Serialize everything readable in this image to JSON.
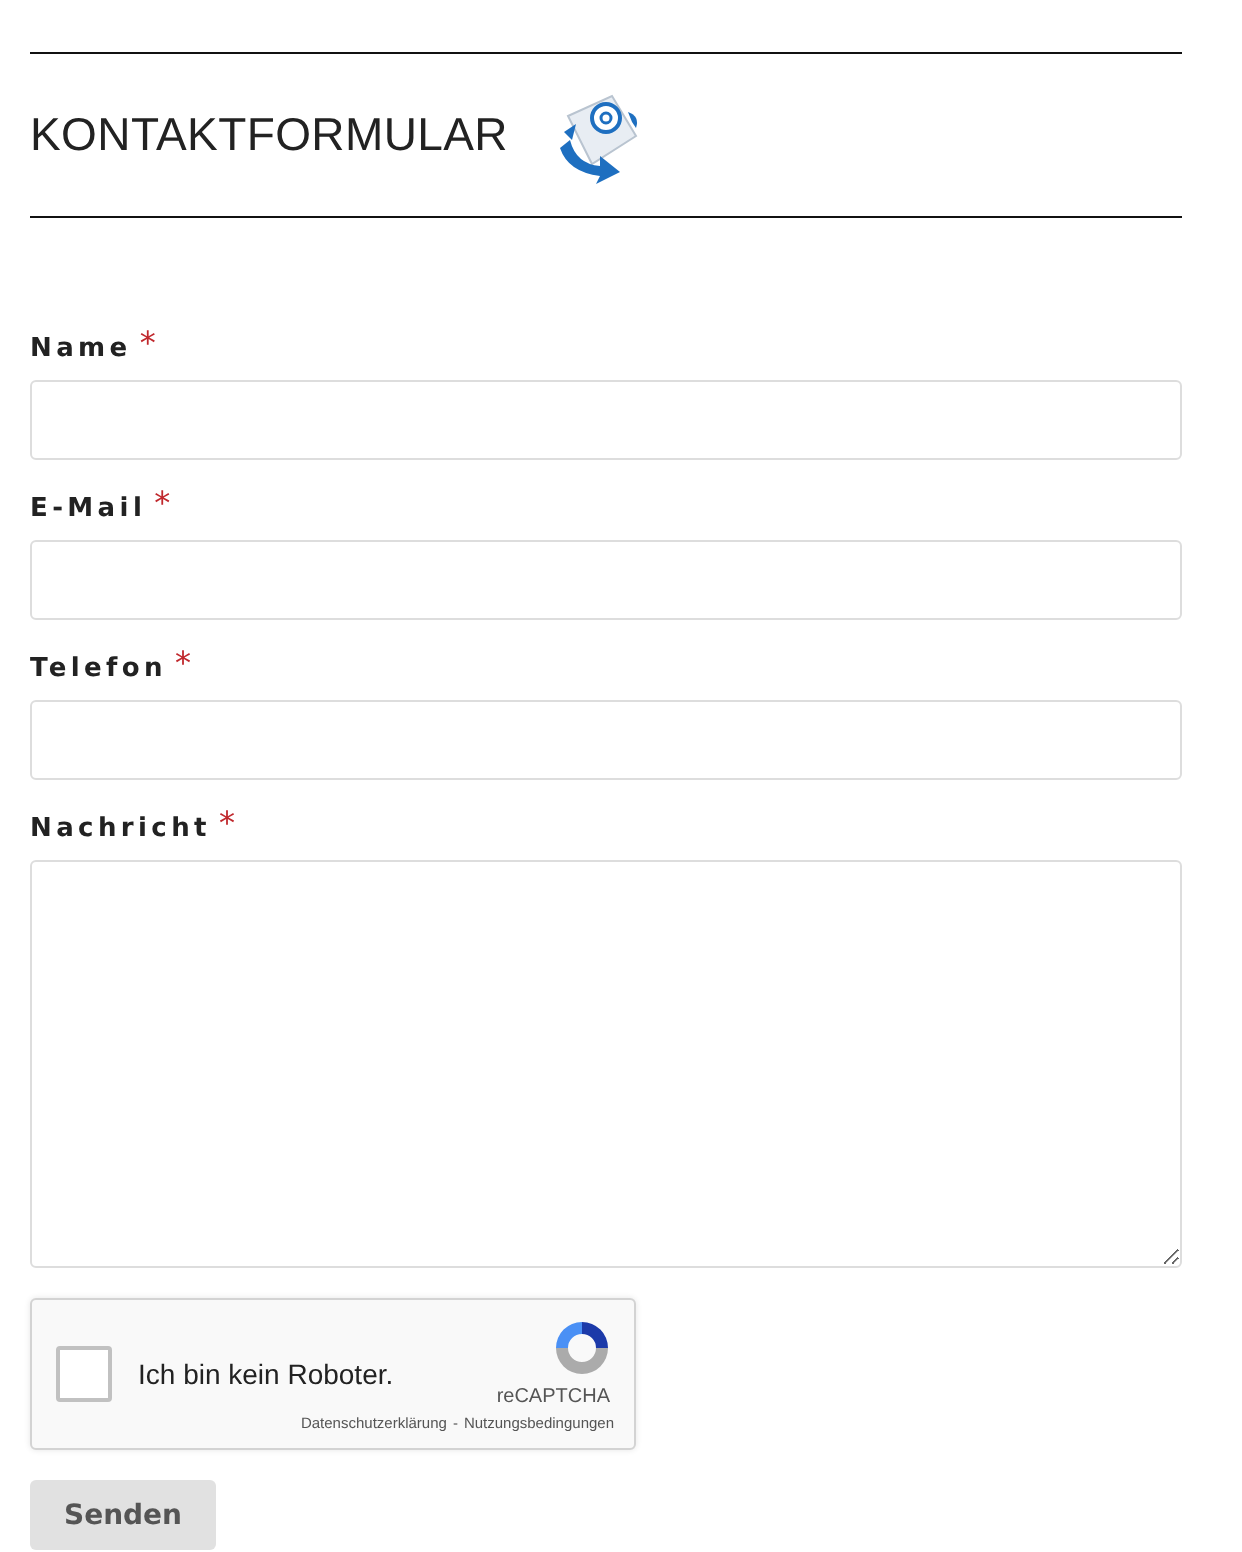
{
  "heading": {
    "title": "KONTAKTFORMULAR"
  },
  "fields": [
    {
      "label": "Name",
      "required": "*",
      "kind": "input"
    },
    {
      "label": "E-Mail",
      "required": "*",
      "kind": "input"
    },
    {
      "label": "Telefon",
      "required": "*",
      "kind": "input"
    },
    {
      "label": "Nachricht",
      "required": "*",
      "kind": "textarea"
    }
  ],
  "captcha": {
    "label": "Ich bin kein Roboter.",
    "checked": false,
    "brand": "reCAPTCHA",
    "privacy": "Datenschutzerklärung",
    "separator": "-",
    "terms": "Nutzungsbedingungen"
  },
  "submit": {
    "label": "Senden"
  }
}
